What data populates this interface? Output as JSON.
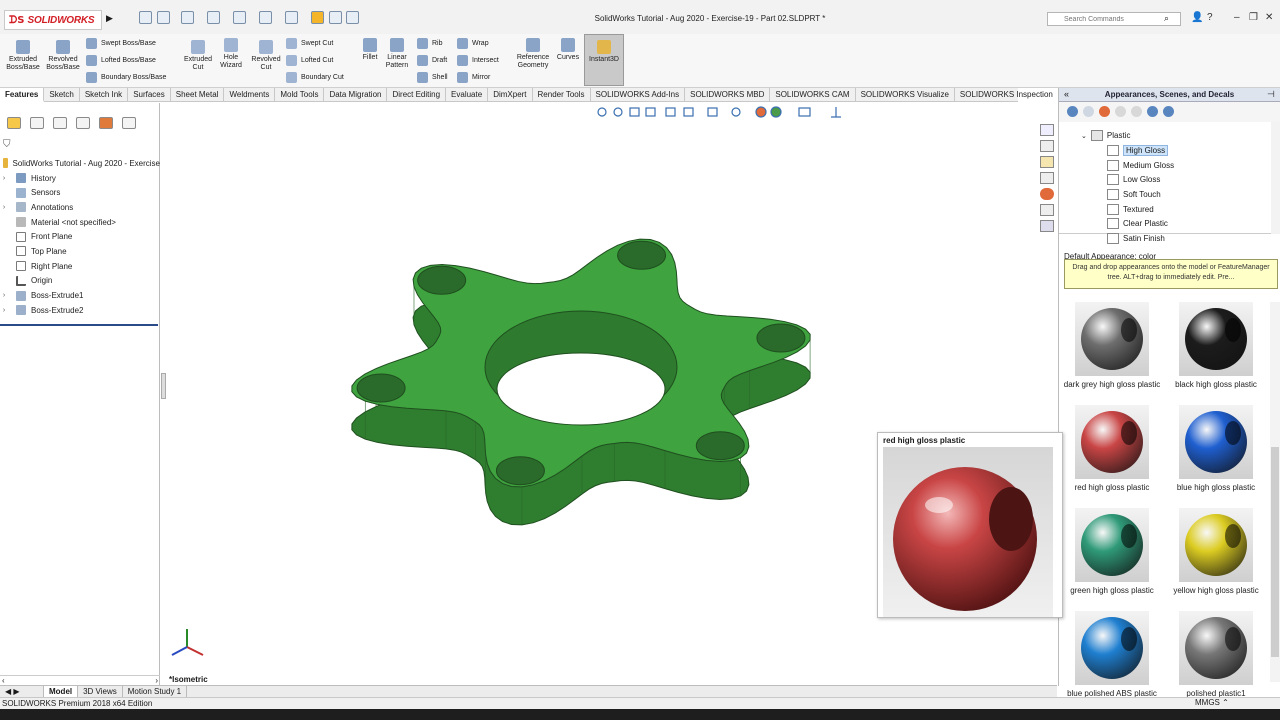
{
  "app": {
    "logo_text": "SOLIDWORKS",
    "window_title": "SolidWorks Tutorial - Aug 2020 - Exercise-19 - Part 02.SLDPRT *",
    "search_placeholder": "Search Commands",
    "help": "?"
  },
  "commands": {
    "big": [
      "Extruded\nBoss/Base",
      "Revolved\nBoss/Base",
      "Extruded\nCut",
      "Hole\nWizard",
      "Revolved\nCut",
      "Fillet",
      "Linear\nPattern",
      "Reference\nGeometry",
      "Curves",
      "Instant3D"
    ],
    "boss_col": [
      "Swept Boss/Base",
      "Lofted Boss/Base",
      "Boundary Boss/Base"
    ],
    "cut_col": [
      "Swept Cut",
      "Lofted Cut",
      "Boundary Cut"
    ],
    "feat_col1": [
      "Rib",
      "Draft",
      "Shell"
    ],
    "feat_col2": [
      "Wrap",
      "Intersect",
      "Mirror"
    ]
  },
  "tabs": [
    "Features",
    "Sketch",
    "Sketch Ink",
    "Surfaces",
    "Sheet Metal",
    "Weldments",
    "Mold Tools",
    "Data Migration",
    "Direct Editing",
    "Evaluate",
    "DimXpert",
    "Render Tools",
    "SOLIDWORKS Add-Ins",
    "SOLIDWORKS MBD",
    "SOLIDWORKS CAM",
    "SOLIDWORKS Visualize",
    "SOLIDWORKS Inspection"
  ],
  "feature_tree": {
    "root": "SolidWorks Tutorial - Aug 2020 - Exercise",
    "items": [
      "History",
      "Sensors",
      "Annotations",
      "Material <not specified>",
      "Front Plane",
      "Top Plane",
      "Right Plane",
      "Origin",
      "Boss-Extrude1",
      "Boss-Extrude2"
    ]
  },
  "viewport": {
    "view_label": "*Isometric",
    "part_color": "#3fa33f"
  },
  "task_pane": {
    "title": "Appearances, Scenes, and Decals",
    "tree_parent": "Plastic",
    "tree_items": [
      "High Gloss",
      "Medium Gloss",
      "Low Gloss",
      "Soft Touch",
      "Textured",
      "Clear Plastic",
      "Satin Finish"
    ],
    "selected": "High Gloss",
    "default_appearance": "Default Appearance: color",
    "hint": "Drag and drop appearances onto the model or FeatureManager tree.  ALT+drag to immediately edit.  Pre...",
    "swatches": [
      {
        "name": "dark grey high gloss plastic",
        "color": "#6e6e6e"
      },
      {
        "name": "black high gloss plastic",
        "color": "#1c1c1c"
      },
      {
        "name": "red high gloss plastic",
        "color": "#c94545"
      },
      {
        "name": "blue high gloss plastic",
        "color": "#1f5fd0"
      },
      {
        "name": "green high gloss plastic",
        "color": "#2f9a78"
      },
      {
        "name": "yellow high gloss plastic",
        "color": "#dccc22"
      },
      {
        "name": "blue polished ABS plastic",
        "color": "#1f7fd0"
      },
      {
        "name": "polished plastic1",
        "color": "#777777"
      }
    ]
  },
  "preview": {
    "title": "red high gloss plastic",
    "color": "#c94545"
  },
  "bottom_tabs": [
    "Model",
    "3D Views",
    "Motion Study 1"
  ],
  "status": {
    "edition": "SOLIDWORKS Premium 2018 x64 Edition",
    "units": "MMGS"
  }
}
